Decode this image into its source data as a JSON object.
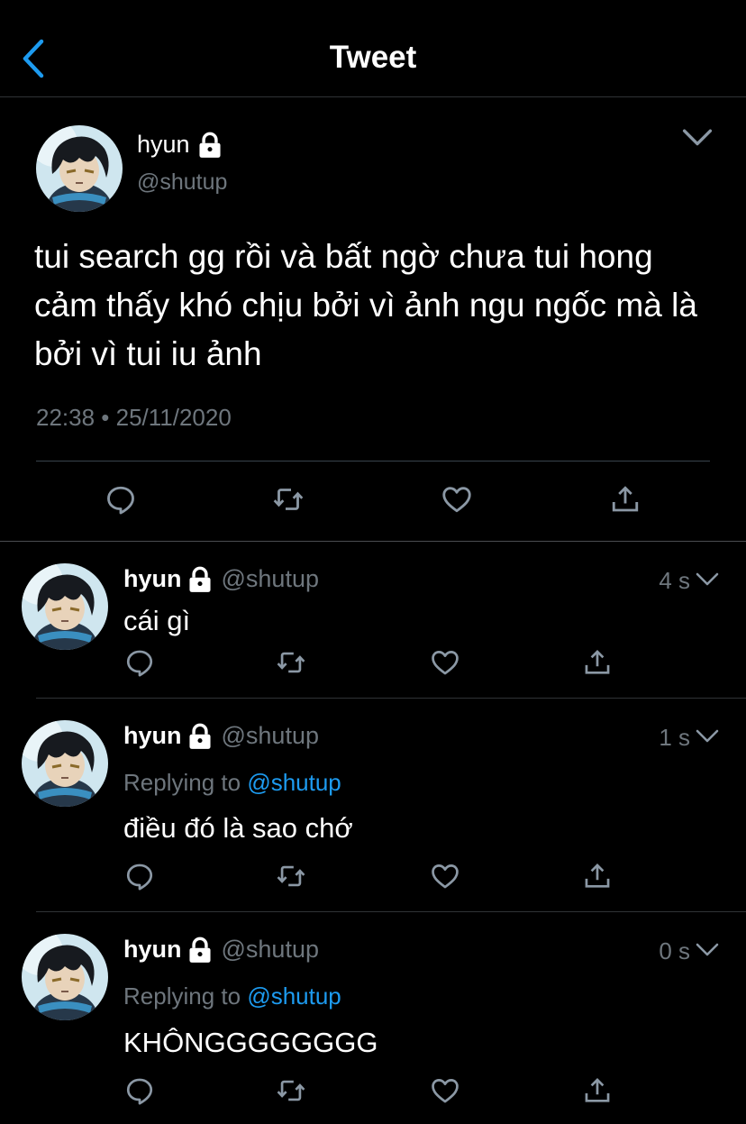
{
  "header": {
    "title": "Tweet"
  },
  "main_tweet": {
    "name": "hyun",
    "handle": "@shutup",
    "text": "tui search gg rồi và bất ngờ chưa tui hong cảm thấy khó chịu bởi vì ảnh ngu ngốc mà là bởi vì tui iu ảnh",
    "timestamp": "22:38 • 25/11/2020"
  },
  "replies": [
    {
      "name": "hyun",
      "handle": "@shutup",
      "time": "4 s",
      "replying_prefix": "",
      "replying_mention": "",
      "text": "cái gì"
    },
    {
      "name": "hyun",
      "handle": "@shutup",
      "time": "1 s",
      "replying_prefix": "Replying to ",
      "replying_mention": "@shutup",
      "text": "điều đó là sao chớ"
    },
    {
      "name": "hyun",
      "handle": "@shutup",
      "time": "0 s",
      "replying_prefix": "Replying to ",
      "replying_mention": "@shutup",
      "text": "KHÔNGGGGGGGG"
    }
  ],
  "colors": {
    "accent": "#1d9bf0",
    "muted": "#6e767d",
    "background": "#000000"
  },
  "icons": [
    "back-icon",
    "lock-icon",
    "chevron-down-icon",
    "reply-icon",
    "retweet-icon",
    "like-icon",
    "share-icon"
  ]
}
